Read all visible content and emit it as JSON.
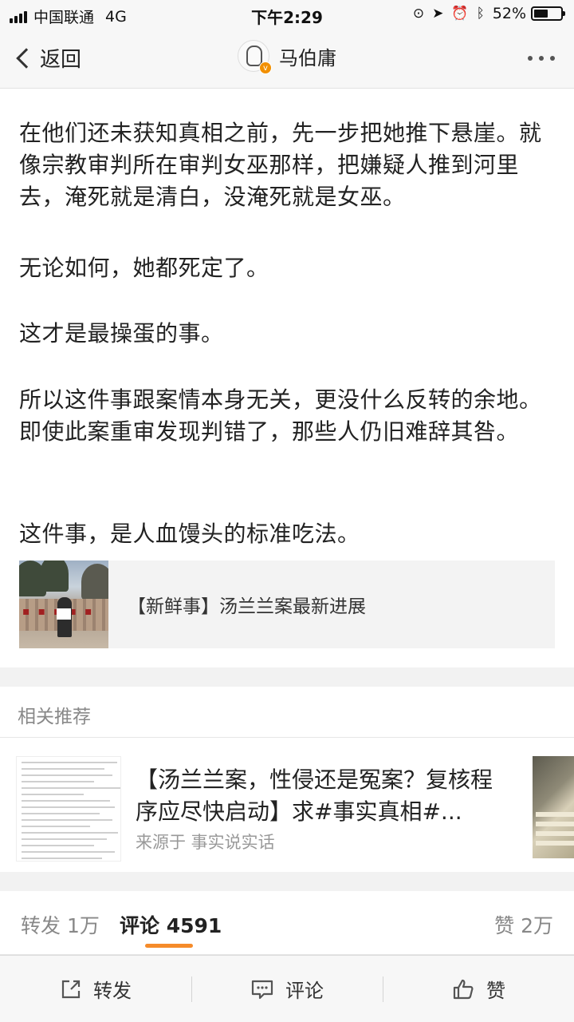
{
  "status_bar": {
    "carrier": "中国联通",
    "network": "4G",
    "time": "下午2:29",
    "battery_percent": "52%",
    "battery_level": 0.52
  },
  "nav": {
    "back_label": "返回",
    "title": "马伯庸",
    "verified_badge": "v"
  },
  "article": {
    "paragraphs": [
      "在他们还未获知真相之前，先一步把她推下悬崖。就像宗教审判所在审判女巫那样，把嫌疑人推到河里去，淹死就是清白，没淹死就是女巫。",
      "无论如何，她都死定了。",
      "这才是最操蛋的事。",
      "所以这件事跟案情本身无关，更没什么反转的余地。即使此案重审发现判错了，那些人仍旧难辞其咎。",
      "这件事，是人血馒头的标准吃法。"
    ],
    "link_card": {
      "text": "【新鲜事】汤兰兰案最新进展"
    }
  },
  "related": {
    "header": "相关推荐",
    "item": {
      "title": "【汤兰兰案，性侵还是冤案？复核程序应尽快启动】求#事实真相#...",
      "source": "来源于 事实说实话"
    }
  },
  "stats": {
    "repost": "转发 1万",
    "comment_label": "评论",
    "comment_count": "4591",
    "like": "赞 2万"
  },
  "toolbar": {
    "repost": "转发",
    "comment": "评论",
    "like": "赞"
  },
  "colors": {
    "accent": "#f58b2a",
    "badge": "#f29000"
  }
}
